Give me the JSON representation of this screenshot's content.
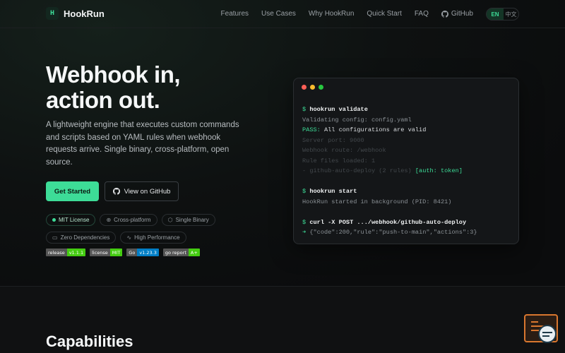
{
  "nav": {
    "brand_logo": "H",
    "brand_name": "HookRun",
    "links": [
      "Features",
      "Use Cases",
      "Why HookRun",
      "Quick Start",
      "FAQ",
      "GitHub"
    ],
    "lang_active": "EN",
    "lang_other": "中文"
  },
  "hero": {
    "title_line1": "Webhook in,",
    "title_line2": "action out.",
    "description": "A lightweight engine that executes custom commands and scripts based on YAML rules when webhook requests arrive. Single binary, cross-platform, open source.",
    "primary_button": "Get Started",
    "secondary_button": "View on GitHub",
    "chips": [
      "MIT License",
      "Cross-platform",
      "Single Binary",
      "Zero Dependencies",
      "High Performance"
    ],
    "shields": [
      {
        "key": "release",
        "value": "v1.1.1",
        "color": "#4c1"
      },
      {
        "key": "license",
        "value": "MIT",
        "color": "#4c1"
      },
      {
        "key": "Go",
        "value": "v1.23.3",
        "color": "#007ec6"
      },
      {
        "key": "go report",
        "value": "A+",
        "color": "#44cc11"
      }
    ]
  },
  "terminal": {
    "dot_colors": [
      "#ff5f57",
      "#febc2e",
      "#28c840"
    ],
    "prompt": "$",
    "cmd1": "hookrun validate",
    "out1": "Validating config: config.yaml",
    "pass_label": "PASS:",
    "pass_text": "All configurations are valid",
    "dim1": "Server port: 9000",
    "dim2": "Webhook route: /webhook",
    "dim3": "Rule files loaded: 1",
    "dim4": "- github-auto-deploy (2 rules)",
    "auth_tag": "[auth: token]",
    "cmd2": "hookrun start",
    "out2": "HookRun started in background (PID: 8421)",
    "cmd3": "curl -X POST .../webhook/github-auto-deploy",
    "arrow": "➜",
    "response": "{\"code\":200,\"rule\":\"push-to-main\",\"actions\":3}"
  },
  "capabilities": {
    "title": "Capabilities"
  },
  "colors": {
    "accent": "#3ddc97",
    "background": "#0b0c0d"
  }
}
